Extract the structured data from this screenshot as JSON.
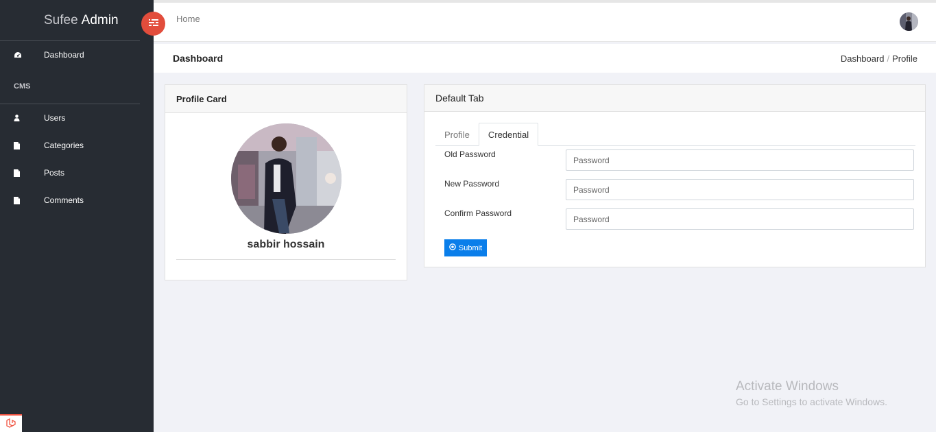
{
  "brand": {
    "light": "Sufee",
    "bold": "Admin"
  },
  "sidebar": {
    "dashboard": {
      "label": "Dashboard",
      "icon": "dashboard-icon"
    },
    "section": "CMS",
    "items": [
      {
        "label": "Users",
        "icon": "user-icon"
      },
      {
        "label": "Categories",
        "icon": "file-icon"
      },
      {
        "label": "Posts",
        "icon": "file-icon"
      },
      {
        "label": "Comments",
        "icon": "file-icon"
      }
    ]
  },
  "header": {
    "home": "Home",
    "toggle_icon": "menu-toggle-icon"
  },
  "breadcrumb": {
    "title": "Dashboard",
    "crumb1": "Dashboard",
    "separator": "/",
    "crumb2": "Profile"
  },
  "profile_card": {
    "title": "Profile Card",
    "name": "sabbir hossain"
  },
  "tab_card": {
    "title": "Default Tab",
    "tabs": [
      "Profile",
      "Credential"
    ],
    "active_tab": "Credential",
    "fields": [
      {
        "label": "Old Password",
        "placeholder": "Password"
      },
      {
        "label": "New Password",
        "placeholder": "Password"
      },
      {
        "label": "Confirm Password",
        "placeholder": "Password"
      }
    ],
    "submit": "Submit"
  },
  "watermark": {
    "line1": "Activate Windows",
    "line2": "Go to Settings to activate Windows."
  },
  "colors": {
    "sidebar": "#272c33",
    "toggle": "#e24d3c",
    "primary": "#0a7eea",
    "background": "#f1f2f7"
  }
}
